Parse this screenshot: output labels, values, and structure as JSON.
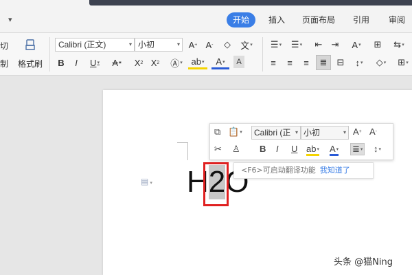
{
  "tabs": [
    {
      "label": "开始",
      "active": true
    },
    {
      "label": "插入"
    },
    {
      "label": "页面布局"
    },
    {
      "label": "引用"
    },
    {
      "label": "审阅"
    }
  ],
  "ribbon": {
    "cut_label": "剪切",
    "copy_label": "复制",
    "format_painter_label": "格式刷",
    "font_name": "Calibri (正文)",
    "font_size": "小初"
  },
  "mini_toolbar": {
    "font_name": "Calibri (正",
    "font_size": "小初"
  },
  "document": {
    "text_h": "H",
    "text_2": "2",
    "text_o": "O"
  },
  "tooltip": {
    "hint": "<F6>可启动翻译功能",
    "link": "我知道了"
  },
  "watermark": "头条 @猫Ning",
  "colors": {
    "accent": "#3a7ee6",
    "highlight_box": "#e02020",
    "selection": "#c8c8c8"
  }
}
